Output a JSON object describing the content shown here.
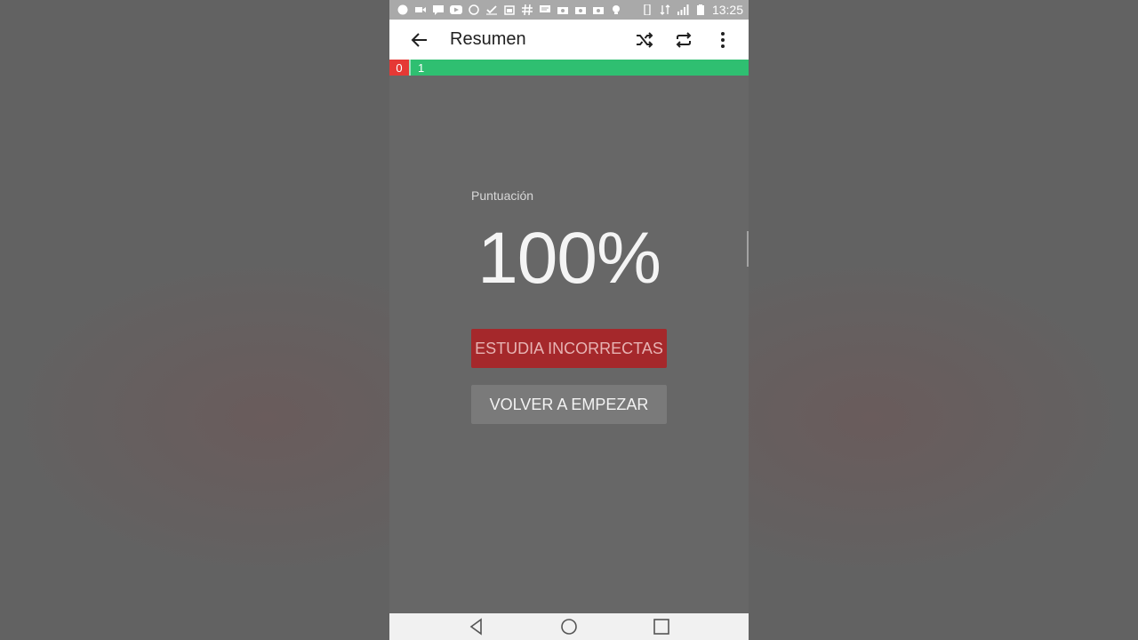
{
  "statusbar": {
    "icons": [
      "record-icon",
      "video-icon",
      "message-icon",
      "youtube-icon",
      "whatsapp-icon",
      "check-icon",
      "calendar-icon",
      "hashtag-icon",
      "chat-icon",
      "photo-icon",
      "photo-icon",
      "photo-icon",
      "bulb-icon"
    ],
    "time": "13:25"
  },
  "appbar": {
    "title": "Resumen",
    "back_icon": "arrow-left-icon",
    "actions": [
      "shuffle-icon",
      "repeat-icon",
      "more-vert-icon"
    ]
  },
  "progress": {
    "incorrect": "0",
    "correct": "1",
    "colors": {
      "incorrect": "#e53935",
      "correct": "#2fbf71"
    }
  },
  "summary": {
    "score_label": "Puntuación",
    "score_value": "100%",
    "study_incorrect_label": "ESTUDIA INCORRECTAS",
    "restart_label": "VOLVER A EMPEZAR"
  },
  "navbar": {
    "buttons": [
      "back-triangle-icon",
      "home-circle-icon",
      "recents-square-icon"
    ]
  }
}
